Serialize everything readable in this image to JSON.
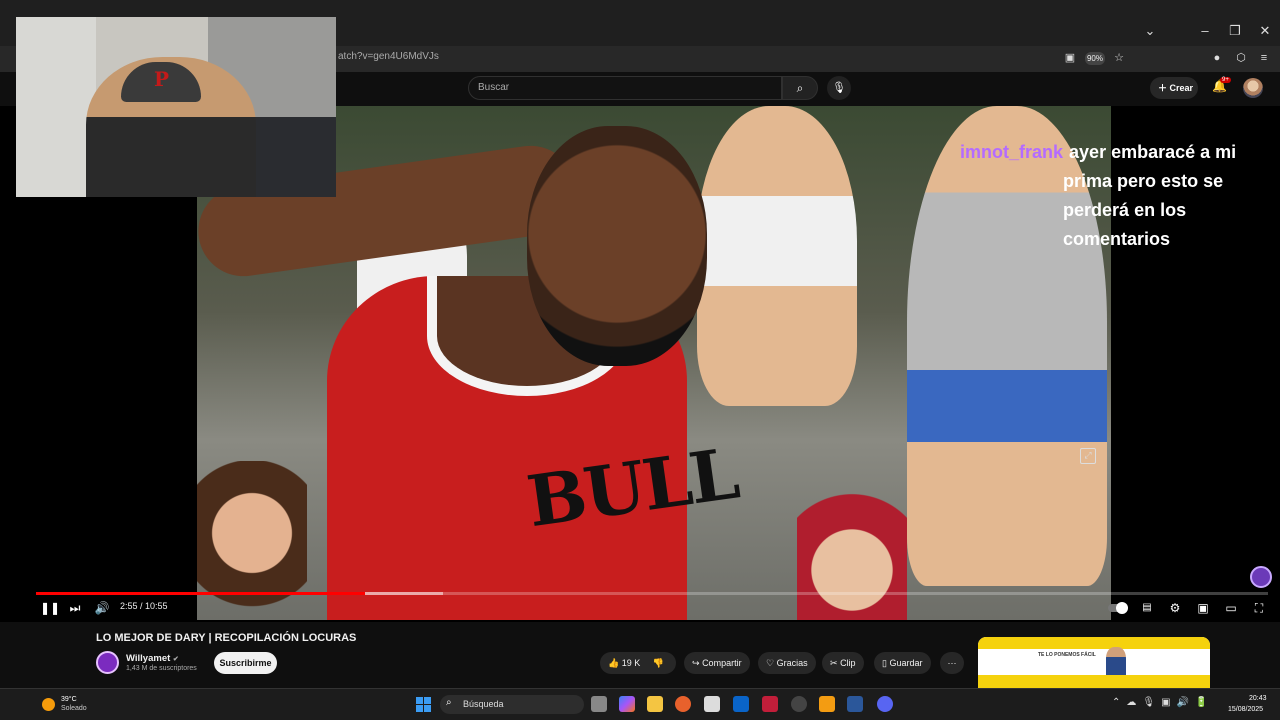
{
  "browser": {
    "url": "atch?v=gen4U6MdVJs",
    "zoom": "90%",
    "window_controls": [
      "⌄",
      "–",
      "❐",
      "✕"
    ]
  },
  "youtube_header": {
    "search_placeholder": "Buscar",
    "create_label": "Crear",
    "notifications_badge": "9+"
  },
  "chat_overlay": {
    "username": "imnot_frank",
    "message": "ayer embaracé a mi prima pero esto se perderá en los comentarios"
  },
  "webcam": {
    "cap_logo": "P"
  },
  "video_content": {
    "jersey_text": "BULL"
  },
  "player": {
    "time": "2:55 / 10:55",
    "progress": 0.267,
    "buffered": 0.33
  },
  "video_info": {
    "title": "LO MEJOR DE DARY | RECOPILACIÓN LOCURAS",
    "channel_name": "Willyamet",
    "verified_icon": "✔",
    "subscribers": "1,43 M de suscriptores",
    "subscribe_label": "Suscribirme",
    "likes": "19 K",
    "share_label": "Compartir",
    "thanks_label": "Gracias",
    "clip_label": "Clip",
    "save_label": "Guardar",
    "more_label": "···"
  },
  "ad": {
    "text": "TE LO PONEMOS FÁCIL"
  },
  "taskbar": {
    "temperature": "39°C",
    "condition": "Soleado",
    "search_text": "Búsqueda",
    "time": "20:43",
    "date": "15/08/2025"
  },
  "colors": {
    "progress_red": "#ff0000",
    "chat_username": "#b46bff",
    "yt_bg": "#0f0f0f"
  }
}
